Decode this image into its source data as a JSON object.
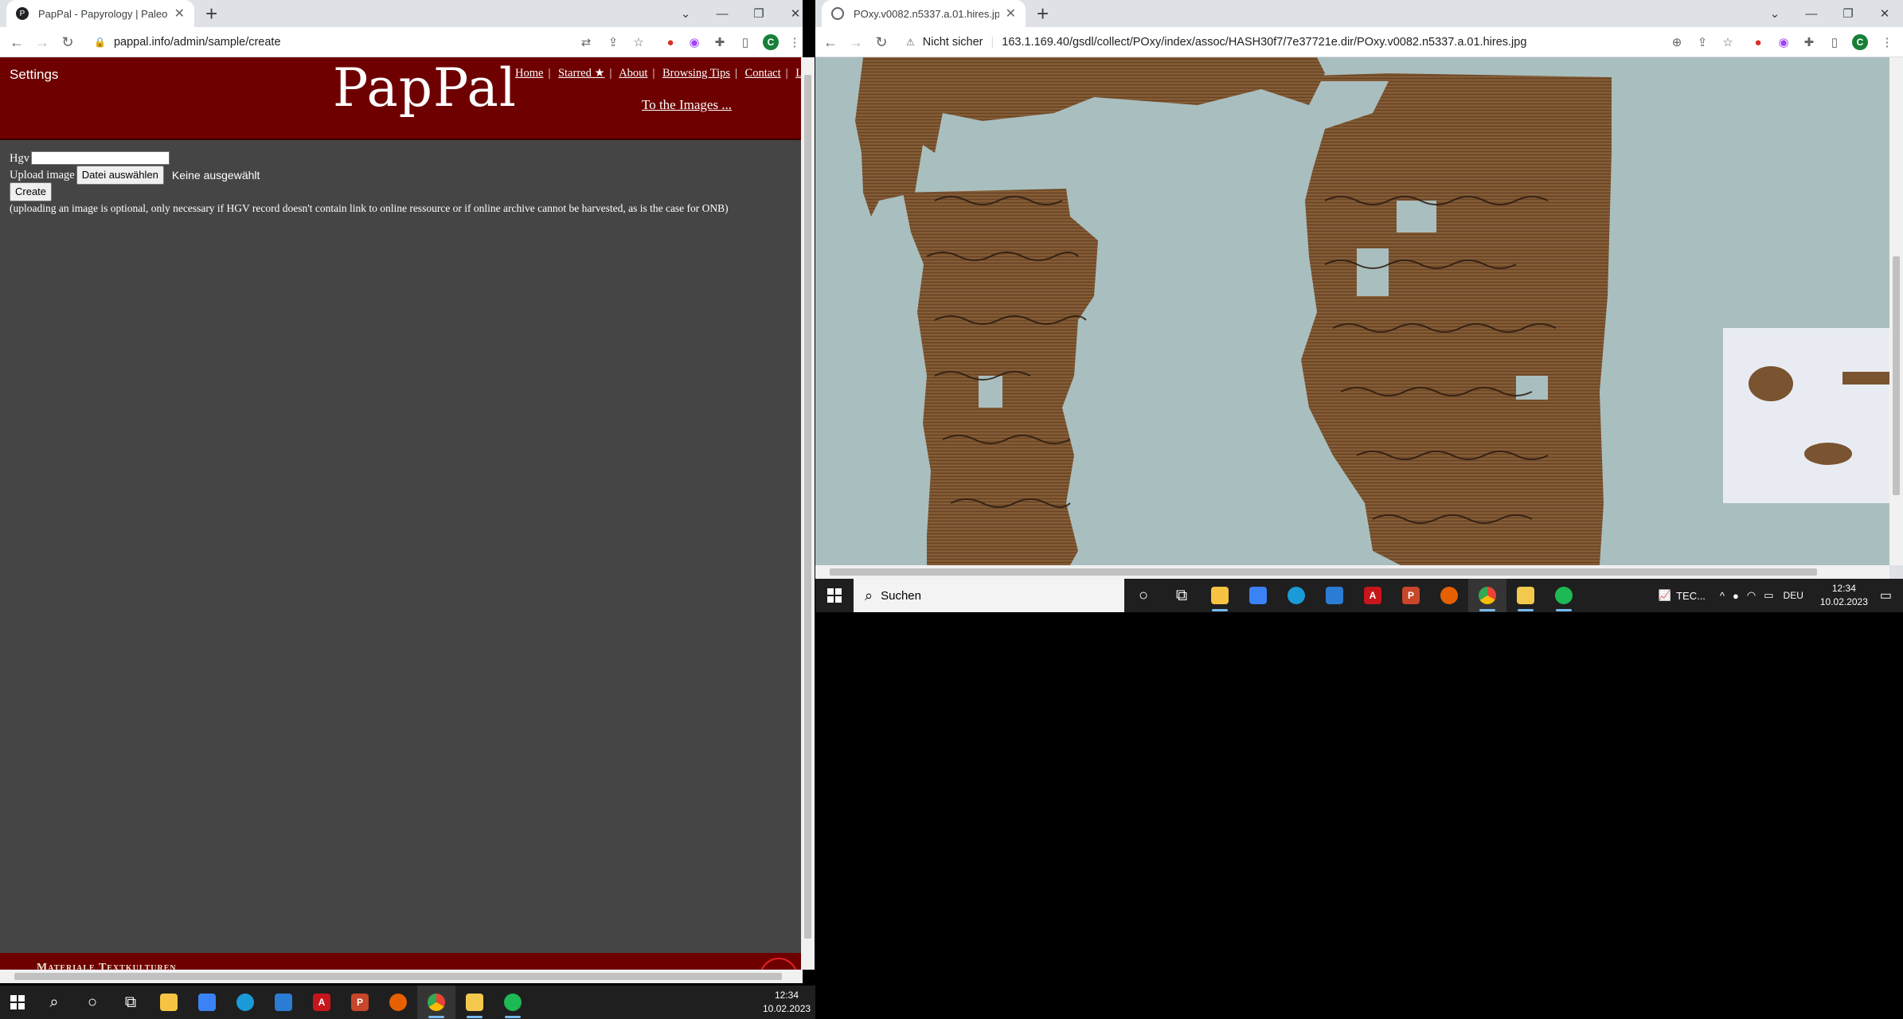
{
  "left_browser": {
    "tab_title": "PapPal - Papyrology | Paleograph",
    "url": "pappal.info/admin/sample/create",
    "profile_initial": "C"
  },
  "pappal": {
    "settings": "Settings",
    "logo": "PapPal",
    "nav": [
      "Home",
      "Starred ★",
      "About",
      "Browsing Tips",
      "Contact",
      "Logou"
    ],
    "to_images": "To the Images ...",
    "form": {
      "hgv_label": "Hgv",
      "hgv_value": "",
      "upload_label": "Upload image",
      "file_button": "Datei auswählen",
      "file_status": "Keine ausgewählt",
      "create_button": "Create",
      "note": "(uploading an image is optional, only necessary if HGV record doesn't contain link to online ressource or if online archive cannot be harvested, as is the case for ONB)"
    },
    "footer": "Materiale Textkulturen"
  },
  "right_browser": {
    "tab_title": "POxy.v0082.n5337.a.01.hires.jpg",
    "security": "Nicht sicher",
    "url": "163.1.169.40/gsdl/collect/POxy/index/assoc/HASH30f7/7e37721e.dir/POxy.v0082.n5337.a.01.hires.jpg",
    "profile_initial": "C"
  },
  "taskbar_right": {
    "search_placeholder": "Suchen",
    "tec": "TEC...",
    "lang": "DEU",
    "time": "12:34",
    "date": "10.02.2023"
  },
  "taskbar_left": {
    "time": "12:34",
    "date": "10.02.2023"
  },
  "colors": {
    "pappal_header": "#6e0000",
    "pappal_body": "#454545",
    "papyrus_bg": "#a9bfbf",
    "papyrus_fiber": "#7a5330"
  }
}
